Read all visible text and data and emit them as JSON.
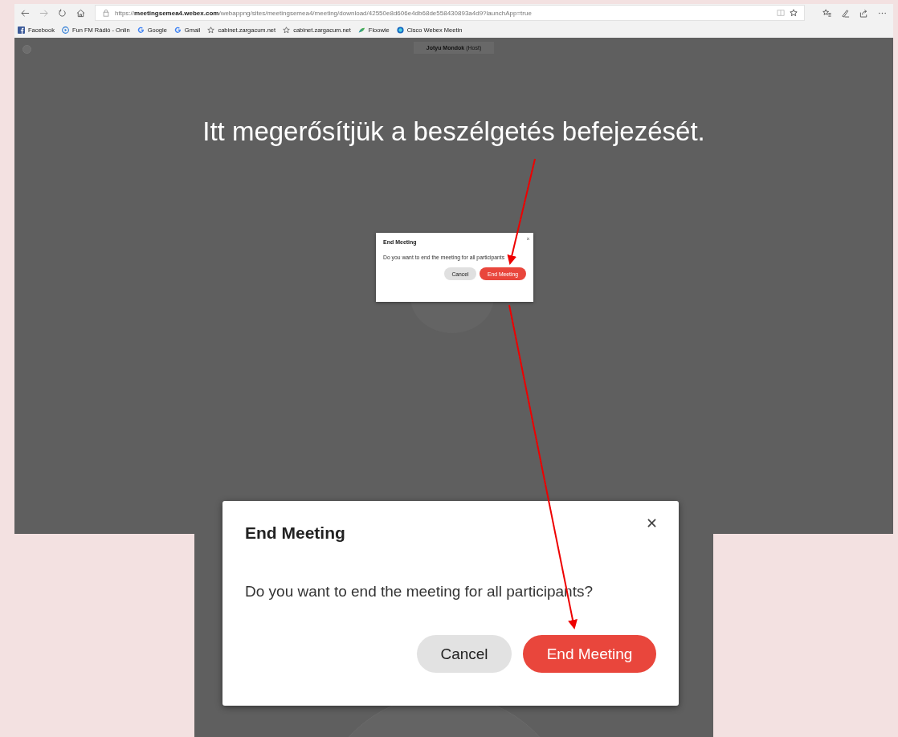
{
  "browser": {
    "url_scheme": "https://",
    "url_host": "meetingsemea4.webex.com",
    "url_path": "/webappng/sites/meetingsemea4/meeting/download/42550e8d606e4db68de558430893a4d9?launchApp=true",
    "bookmarks": [
      {
        "label": "Facebook",
        "kind": "facebook"
      },
      {
        "label": "Fun FM Rádió - Onlin",
        "kind": "radio"
      },
      {
        "label": "Google",
        "kind": "google"
      },
      {
        "label": "Gmail",
        "kind": "google"
      },
      {
        "label": "cabinet.zargacum.net",
        "kind": "star"
      },
      {
        "label": "cabinet.zargacum.net",
        "kind": "star"
      },
      {
        "label": "Floowie",
        "kind": "leaf"
      },
      {
        "label": "Cisco Webex Meetin",
        "kind": "webex"
      }
    ]
  },
  "meeting": {
    "host_name": "Jotyu Mondok",
    "host_tag": "(Host)"
  },
  "annotation": "Itt megerősítjük a beszélgetés befejezését.",
  "dialog": {
    "title": "End Meeting",
    "message": "Do you want to end the meeting for all participants",
    "buttons": [
      {
        "label": "Cancel",
        "kind": "secondary"
      },
      {
        "label": "End Meeting",
        "kind": "primary"
      }
    ]
  },
  "zoomed_dialog": {
    "title": "End Meeting",
    "message": "Do you want to end the meeting for all participants?",
    "buttons": [
      {
        "label": "Cancel",
        "kind": "secondary"
      },
      {
        "label": "End Meeting",
        "kind": "primary"
      }
    ]
  }
}
